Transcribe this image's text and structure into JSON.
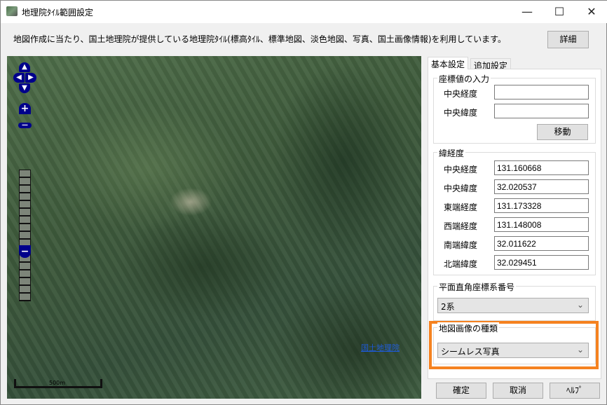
{
  "window": {
    "title": "地理院ﾀｲﾙ範囲設定",
    "min": "—",
    "max": "☐",
    "close": "✕"
  },
  "description": "地図作成に当たり、国土地理院が提供している地理院ﾀｲﾙ(標高ﾀｲﾙ、標準地図、淡色地図、写真、国土画像情報)を利用しています。",
  "details_button": "詳細",
  "map": {
    "credit": "国土地理院",
    "scale": "500m",
    "zoom_in": "+",
    "zoom_out": "−"
  },
  "tabs": [
    "基本設定",
    "追加設定"
  ],
  "coord_input": {
    "title": "座標値の入力",
    "lon_label": "中央経度",
    "lat_label": "中央緯度",
    "lon_value": "",
    "lat_value": "",
    "move_button": "移動"
  },
  "latlon": {
    "title": "緯経度",
    "rows": [
      {
        "label": "中央経度",
        "value": "131.160668"
      },
      {
        "label": "中央緯度",
        "value": "32.020537"
      },
      {
        "label": "東端経度",
        "value": "131.173328"
      },
      {
        "label": "西端経度",
        "value": "131.148008"
      },
      {
        "label": "南端緯度",
        "value": "32.011622"
      },
      {
        "label": "北端緯度",
        "value": "32.029451"
      }
    ]
  },
  "plane": {
    "title": "平面直角座標系番号",
    "selected": "2系"
  },
  "image_type": {
    "title": "地図画像の種類",
    "selected": "シームレス写真",
    "highlight_color": "#f58220"
  },
  "buttons": {
    "ok": "確定",
    "cancel": "取消",
    "help": "ﾍﾙﾌﾟ"
  }
}
